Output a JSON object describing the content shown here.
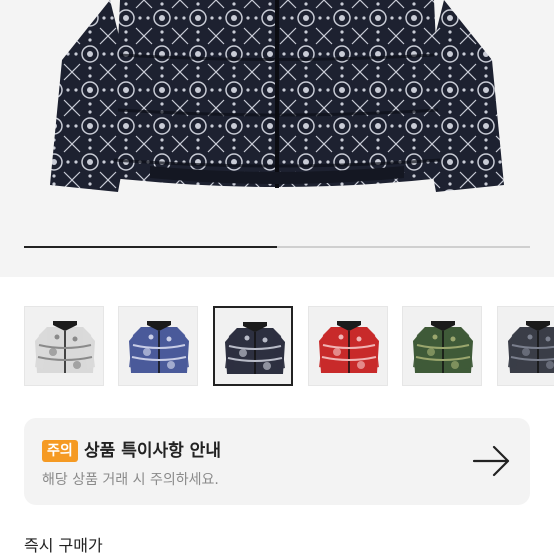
{
  "product_gallery": {
    "image_alt": "bandana print down puffer jacket",
    "progress_fraction": 0.5
  },
  "thumbnails": [
    {
      "name": "thumb-white-bandana",
      "color": "#d9d9d9",
      "pattern": "#8a8a8a"
    },
    {
      "name": "thumb-blue-bandana",
      "color": "#4a5a9a",
      "pattern": "#c8cde6"
    },
    {
      "name": "thumb-black-bandana",
      "color": "#2d3040",
      "pattern": "#b9bcc8",
      "selected": true
    },
    {
      "name": "thumb-red-bandana",
      "color": "#c82a2a",
      "pattern": "#f0b4b4"
    },
    {
      "name": "thumb-camo",
      "color": "#3f5a38",
      "pattern": "#9aa66d"
    },
    {
      "name": "thumb-grey-camo",
      "color": "#3a3d47",
      "pattern": "#7a7f8d"
    }
  ],
  "notice": {
    "badge": "주의",
    "title": "상품 특이사항 안내",
    "subtitle": "해당 상품 거래 시 주의하세요.",
    "arrow_icon": "arrow-right-icon"
  },
  "section": {
    "label": "즉시 구매가"
  },
  "colors": {
    "accent": "#f59a23",
    "text": "#222222",
    "muted": "#8a8a8a"
  }
}
